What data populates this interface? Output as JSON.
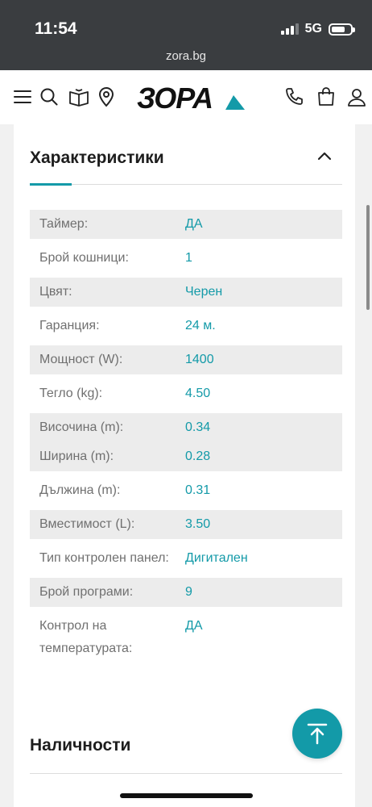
{
  "status_bar": {
    "time": "11:54",
    "network": "5G",
    "battery_level": 0.72
  },
  "browser": {
    "url": "zora.bg"
  },
  "header": {
    "logo_text": "ЗОРА",
    "icons": [
      "menu-icon",
      "search-icon",
      "catalog-book-icon",
      "location-pin-icon",
      "phone-icon",
      "shopping-bag-icon",
      "user-icon"
    ]
  },
  "characteristics": {
    "title": "Характеристики",
    "rows": [
      {
        "key": "Таймер:",
        "value": "ДА",
        "shaded": true
      },
      {
        "key": "Брой кошници:",
        "value": "1",
        "shaded": false
      },
      {
        "key": "Цвят:",
        "value": "Черен",
        "shaded": true
      },
      {
        "key": "Гаранция:",
        "value": "24 м.",
        "shaded": false
      },
      {
        "key": "Мощност (W):",
        "value": "1400",
        "shaded": true
      },
      {
        "key": "Тегло (kg):",
        "value": "4.50",
        "shaded": false
      },
      {
        "key": "Височина (m):",
        "value": "0.34",
        "shaded": true
      },
      {
        "key": "Ширина (m):",
        "value": "0.28",
        "shaded": true
      },
      {
        "key": "Дължина (m):",
        "value": "0.31",
        "shaded": false
      },
      {
        "key": "Вместимост (L):",
        "value": "3.50",
        "shaded": true
      },
      {
        "key": "Тип контролен панел:",
        "value": "Дигитален",
        "shaded": false
      },
      {
        "key": "Брой програми:",
        "value": "9",
        "shaded": true
      },
      {
        "key": "Контрол на температурата:",
        "value": "ДА",
        "shaded": false
      }
    ]
  },
  "availability": {
    "title": "Наличности"
  },
  "colors": {
    "accent": "#139aa8",
    "text_dark": "#1d1d1d",
    "text_muted": "#707070",
    "row_shade": "#ececec"
  }
}
